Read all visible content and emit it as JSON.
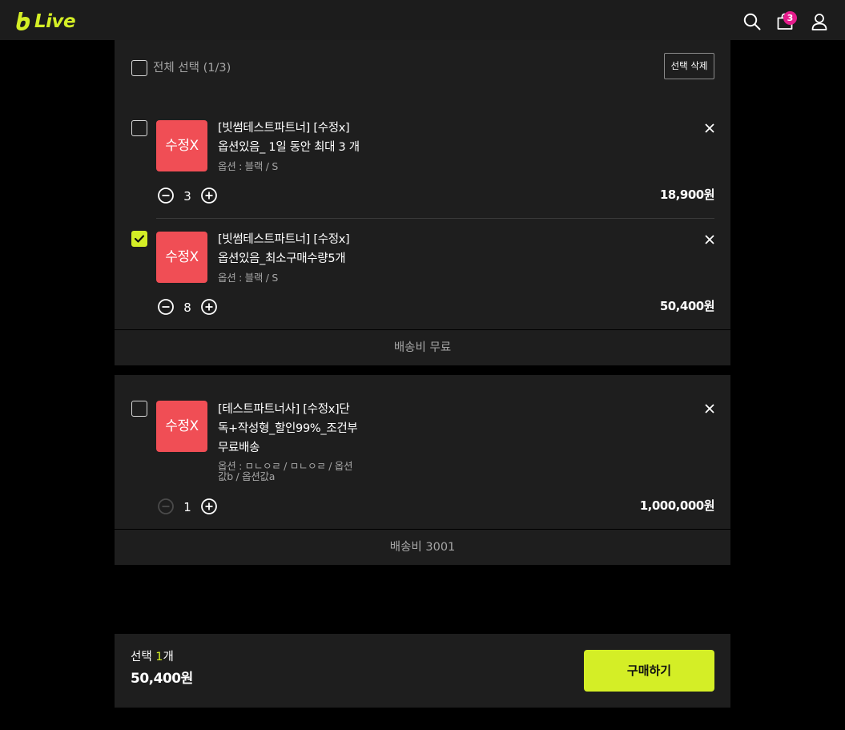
{
  "header": {
    "logo_text": "Live",
    "cart_count": "3",
    "icons": [
      "search-icon",
      "cart-icon",
      "user-icon"
    ],
    "brand_color": "#d4ee26",
    "badge_color": "#e51c8c"
  },
  "select_all": {
    "label": "전체 선택 (1/3)",
    "checked": false
  },
  "delete_selected_label": "선택 삭제",
  "groups": [
    {
      "items": [
        {
          "thumb_text": "수정X",
          "name_line1": "[빗썸테스트파트너] [수정x]",
          "name_line2": "옵션있음_ 1일 동안 최대 3 개",
          "option": "옵션 : 블랙 / S",
          "quantity": "3",
          "price": "18,900원",
          "checked": false,
          "minus_enabled": true
        },
        {
          "thumb_text": "수정X",
          "name_line1": "[빗썸테스트파트너] [수정x]",
          "name_line2": "옵션있음_최소구매수량5개",
          "option": "옵션 : 블랙 / S",
          "quantity": "8",
          "price": "50,400원",
          "checked": true,
          "minus_enabled": true
        }
      ],
      "shipping": "배송비 무료"
    },
    {
      "items": [
        {
          "thumb_text": "수정X",
          "name_line1": "[테스트파트너사] [수정x]단",
          "name_line2": "독+작성형_할인99%_조건부",
          "name_line3": "무료배송",
          "option_line1": "옵션 : ㅁㄴㅇㄹ / ㅁㄴㅇㄹ / 옵션",
          "option_line2": "값b / 옵션값a",
          "quantity": "1",
          "price": "1,000,000원",
          "checked": false,
          "minus_enabled": false
        }
      ],
      "shipping": "배송비 3001"
    }
  ],
  "footer": {
    "selected_prefix": "선택 ",
    "selected_count": "1",
    "selected_suffix": "개",
    "total": "50,400원",
    "buy_label": "구매하기"
  }
}
